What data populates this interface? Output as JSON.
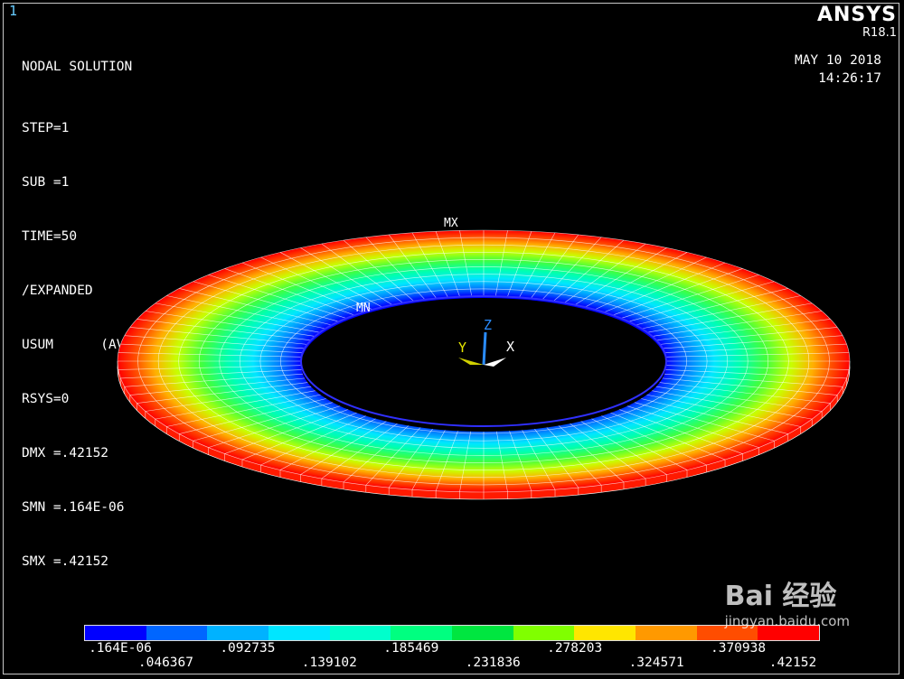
{
  "window": {
    "number": "1"
  },
  "info": {
    "title": "NODAL SOLUTION",
    "lines": [
      "STEP=1",
      "SUB =1",
      "TIME=50",
      "/EXPANDED",
      "USUM      (AVG)",
      "RSYS=0",
      "DMX =.42152",
      "SMN =.164E-06",
      "SMX =.42152"
    ]
  },
  "logo": {
    "name": "ANSYS",
    "release": "R18.1"
  },
  "timestamp": {
    "date": "MAY 10 2018",
    "time": "14:26:17"
  },
  "markers": {
    "max": "MX",
    "min": "MN"
  },
  "triad": {
    "z": "Z",
    "y": "Y",
    "x": "X",
    "colors": {
      "z": "#2a8cff",
      "y": "#e8e800",
      "x": "#ffffff"
    }
  },
  "contour": {
    "colors": [
      "#0000ff",
      "#0066ff",
      "#00b2ff",
      "#00e6ff",
      "#00ffcc",
      "#00ff80",
      "#00e640",
      "#80ff00",
      "#ffe600",
      "#ff9900",
      "#ff4d00",
      "#ff0000"
    ],
    "labels_bottom": [
      ".164E-06",
      ".092735",
      ".185469",
      ".278203",
      ".370938"
    ],
    "labels_top": [
      ".046367",
      ".139102",
      ".231836",
      ".324571",
      ".42152"
    ]
  },
  "watermark": {
    "brand": "Bai 经验",
    "url": "jingyan.baidu.com"
  }
}
